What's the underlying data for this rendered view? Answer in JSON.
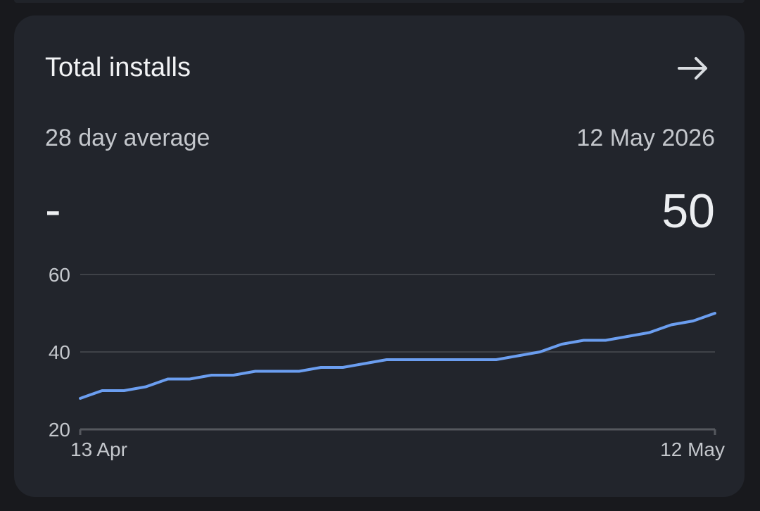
{
  "card": {
    "title": "Total installs",
    "arrow_icon": "arrow-right-icon",
    "average_label": "28 day average",
    "average_value": "-",
    "date_label": "12 May 2026",
    "date_value": "50"
  },
  "colors": {
    "background": "#18191d",
    "card": "#22252c",
    "line": "#6b9ef0",
    "grid": "#3f4248"
  },
  "chart_data": {
    "type": "line",
    "title": "",
    "xlabel": "",
    "ylabel": "",
    "y_ticks": [
      20,
      40,
      60
    ],
    "ylim": [
      20,
      60
    ],
    "x_tick_labels": [
      "13 Apr",
      "12 May"
    ],
    "grid": true,
    "series": [
      {
        "x": [
          "13 Apr",
          "14 Apr",
          "15 Apr",
          "16 Apr",
          "17 Apr",
          "18 Apr",
          "19 Apr",
          "20 Apr",
          "21 Apr",
          "22 Apr",
          "23 Apr",
          "24 Apr",
          "25 Apr",
          "26 Apr",
          "27 Apr",
          "28 Apr",
          "29 Apr",
          "30 Apr",
          "1 May",
          "2 May",
          "3 May",
          "4 May",
          "5 May",
          "6 May",
          "7 May",
          "8 May",
          "9 May",
          "10 May",
          "11 May",
          "12 May"
        ],
        "values": [
          28,
          30,
          30,
          31,
          33,
          33,
          34,
          34,
          35,
          35,
          35,
          36,
          36,
          37,
          38,
          38,
          38,
          38,
          38,
          38,
          39,
          40,
          42,
          43,
          43,
          44,
          45,
          47,
          48,
          50
        ]
      }
    ]
  }
}
